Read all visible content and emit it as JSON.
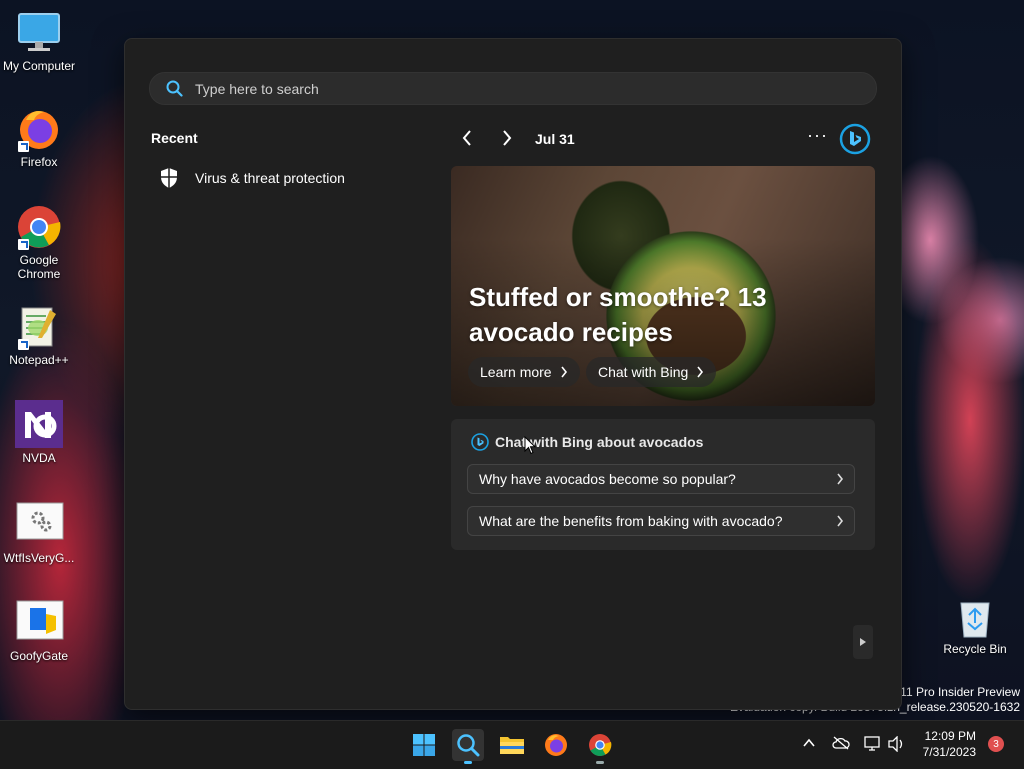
{
  "desktop": {
    "icons": [
      {
        "label": "My Computer"
      },
      {
        "label": "Firefox"
      },
      {
        "label": "Google Chrome"
      },
      {
        "label": "Notepad++"
      },
      {
        "label": "NVDA"
      },
      {
        "label": "WtfIsVeryG..."
      },
      {
        "label": "GoofyGate"
      }
    ],
    "recycle_bin": "Recycle Bin",
    "watermark_line1": "11 Pro Insider Preview",
    "watermark_line2": "Evaluation copy. Build 25375.zn_release.230520-1632"
  },
  "search": {
    "placeholder": "Type here to search",
    "recent_title": "Recent",
    "recent_items": [
      {
        "label": "Virus & threat protection"
      }
    ],
    "date": "Jul 31",
    "hero": {
      "title": "Stuffed or smoothie? 13 avocado recipes",
      "learn_more": "Learn more",
      "chat_with_bing": "Chat with Bing"
    },
    "chat_card": {
      "title": "Chat with Bing about avocados",
      "questions": [
        "Why have avocados become so popular?",
        "What are the benefits from baking with avocado?"
      ]
    }
  },
  "taskbar": {
    "time": "12:09 PM",
    "date": "7/31/2023",
    "notification_count": "3"
  },
  "colors": {
    "accent": "#4cc2ff",
    "bing_blue": "#1ba1e2",
    "panel_bg": "#1f1f1f"
  }
}
